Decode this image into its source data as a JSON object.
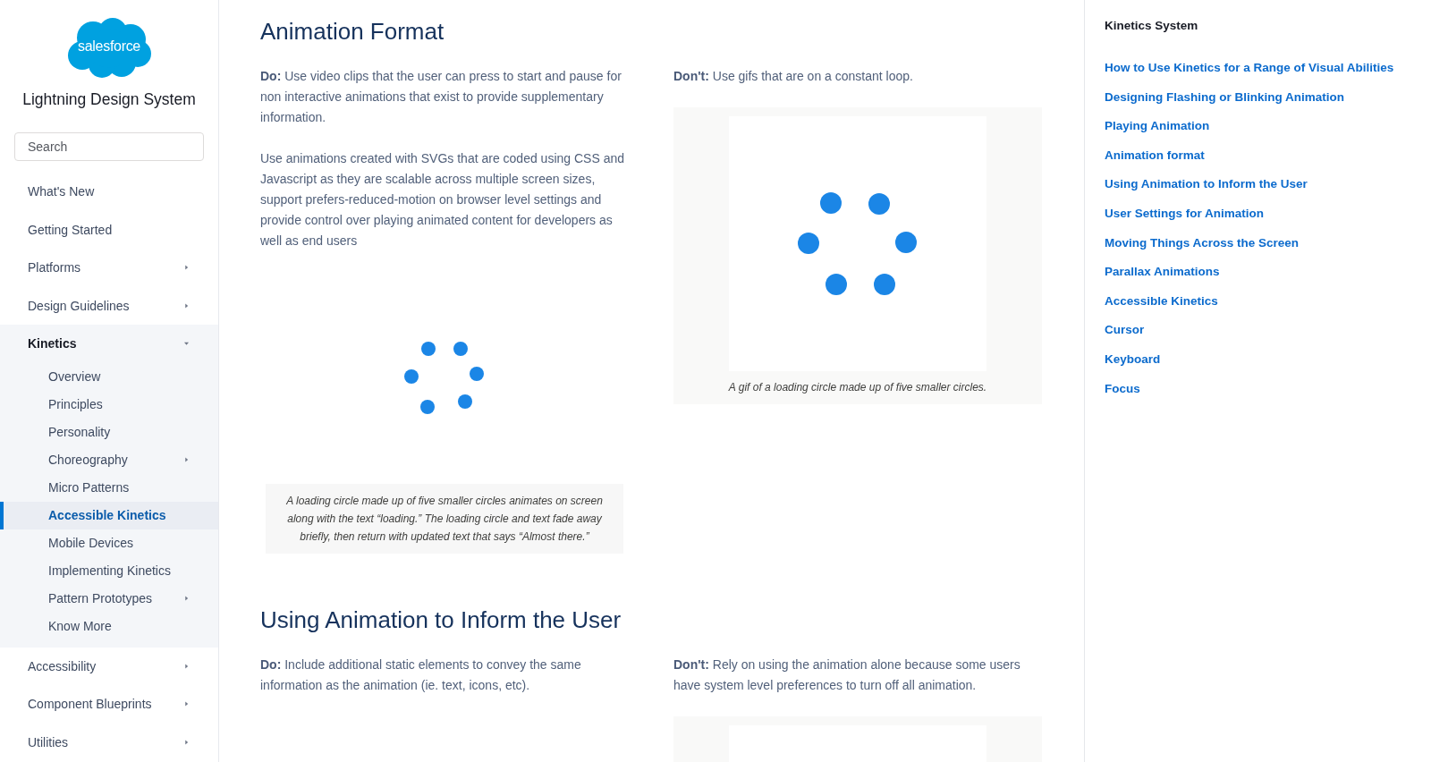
{
  "sidebar": {
    "logo": {
      "text": "salesforce"
    },
    "title": "Lightning Design System",
    "search": {
      "placeholder": "Search"
    },
    "nav": [
      {
        "label": "What's New",
        "kind": "page",
        "selected": false
      },
      {
        "label": "Getting Started",
        "kind": "page",
        "selected": false
      },
      {
        "label": "Platforms",
        "kind": "section",
        "expanded": false,
        "selected": false
      },
      {
        "label": "Design Guidelines",
        "kind": "section",
        "expanded": false,
        "selected": false
      },
      {
        "label": "Kinetics",
        "kind": "section",
        "expanded": true,
        "selected": false,
        "children": [
          {
            "label": "Overview",
            "kind": "page",
            "selected": false
          },
          {
            "label": "Principles",
            "kind": "page",
            "selected": false
          },
          {
            "label": "Personality",
            "kind": "page",
            "selected": false
          },
          {
            "label": "Choreography",
            "kind": "section",
            "expanded": false,
            "selected": false
          },
          {
            "label": "Micro Patterns",
            "kind": "page",
            "selected": false
          },
          {
            "label": "Accessible Kinetics",
            "kind": "page",
            "selected": true
          },
          {
            "label": "Mobile Devices",
            "kind": "page",
            "selected": false
          },
          {
            "label": "Implementing Kinetics",
            "kind": "page",
            "selected": false
          },
          {
            "label": "Pattern Prototypes",
            "kind": "section",
            "expanded": false,
            "selected": false
          },
          {
            "label": "Know More",
            "kind": "page",
            "selected": false
          }
        ]
      },
      {
        "label": "Accessibility",
        "kind": "section",
        "expanded": false,
        "selected": false
      },
      {
        "label": "Component Blueprints",
        "kind": "section",
        "expanded": false,
        "selected": false
      },
      {
        "label": "Utilities",
        "kind": "section",
        "expanded": false,
        "selected": false
      }
    ]
  },
  "main": {
    "sections": [
      {
        "heading": "Animation Format",
        "columns": [
          {
            "paragraphs": [
              "**Do:** Use video clips that the user can press to start and pause for non interactive animations that exist to provide supplementary information.",
              "Use animations created with SVGs that are coded using CSS and Javascript as they are scalable across multiple screen sizes, support prefers-reduced-motion on browser level settings and provide control over playing animated content for developers as well as end users"
            ],
            "figure": {
              "frame": false,
              "spinner": true,
              "caption": "A loading circle made up of five smaller circles animates on screen along with the text “loading.” The loading circle and text fade away briefly, then return with updated text that says “Almost there.”"
            }
          },
          {
            "paragraphs": [
              "**Don't:** Use gifs that are on a constant loop."
            ],
            "figure": {
              "frame": true,
              "spinner": true,
              "caption": "A gif of a loading circle made up of five smaller circles."
            }
          }
        ]
      },
      {
        "heading": "Using Animation to Inform the User",
        "columns": [
          {
            "paragraphs": [
              "**Do:** Include additional static elements to convey the same information as the animation (ie. text, icons, etc)."
            ]
          },
          {
            "paragraphs": [
              "**Don't:** Rely on using the animation alone because some users have system level preferences to turn off all animation."
            ],
            "figure": {
              "frame": true,
              "spinner": false
            }
          }
        ]
      }
    ]
  },
  "toc": {
    "title": "Kinetics System",
    "links": [
      "How to Use Kinetics for a Range of Visual Abilities",
      "Designing Flashing or Blinking Animation",
      "Playing Animation",
      "Animation format",
      "Using Animation to Inform the User",
      "User Settings for Animation",
      "Moving Things Across the Screen",
      "Parallax Animations",
      "Accessible Kinetics",
      "Cursor",
      "Keyboard",
      "Focus"
    ]
  }
}
